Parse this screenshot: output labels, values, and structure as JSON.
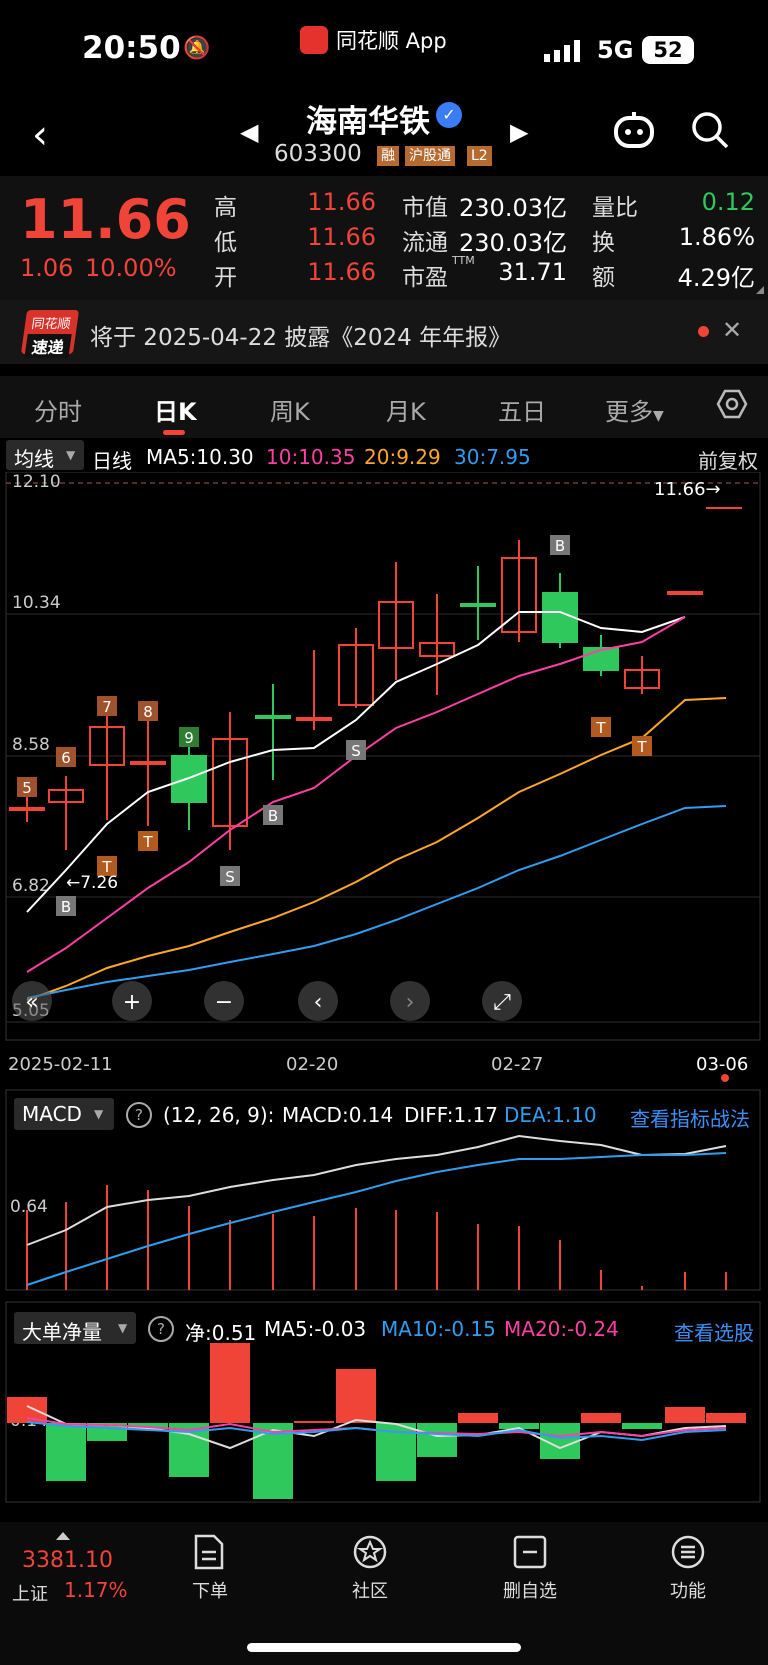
{
  "status_bar": {
    "time": "20:50",
    "app": "同花顺 App",
    "network": "5G",
    "battery": "52"
  },
  "stock": {
    "name": "海南华铁",
    "code": "603300",
    "tags": [
      "融",
      "沪股通",
      "L2"
    ]
  },
  "quote": {
    "price": "11.66",
    "change": "1.06",
    "change_pct": "10.00%",
    "rows": [
      {
        "l1": "高",
        "v1": "11.66",
        "l2": "市值",
        "v2": "230.03亿",
        "l3": "量比",
        "v3": "0.12"
      },
      {
        "l1": "低",
        "v1": "11.66",
        "l2": "流通",
        "v2": "230.03亿",
        "l3": "换",
        "v3": "1.86%"
      },
      {
        "l1": "开",
        "v1": "11.66",
        "l2": "市盈",
        "v2": "31.71",
        "l3": "额",
        "v3": "4.29亿"
      }
    ],
    "pe_sup": "TTM"
  },
  "notice": {
    "logo_top": "同花顺",
    "logo_bottom": "速递",
    "text": "将于 2025-04-22 披露《2024 年年报》"
  },
  "tabs": [
    "分时",
    "日K",
    "周K",
    "月K",
    "五日",
    "更多"
  ],
  "active_tab": "日K",
  "ma_legend": {
    "type": "均线",
    "period": "日线",
    "ma5": "MA5:10.30",
    "ma10": "10:10.35",
    "ma20": "20:9.29",
    "ma30": "30:7.95",
    "adjust": "前复权"
  },
  "kline": {
    "y_labels": [
      "12.10",
      "10.34",
      "8.58",
      "6.82",
      "5.05"
    ],
    "last_price_marker": "11.66→",
    "low_marker": "←7.26",
    "x_labels": [
      "2025-02-11",
      "02-20",
      "02-27",
      "03-06"
    ],
    "controls": [
      "«",
      "+",
      "−",
      "‹",
      "›",
      "⤢"
    ],
    "colors": {
      "up": "#f04438",
      "down": "#2ec85c",
      "ma5": "#ffffff",
      "ma10": "#ff3fa4",
      "ma20": "#ffa726",
      "ma30": "#2f9ef0"
    }
  },
  "macd": {
    "name": "MACD",
    "params": "(12, 26, 9):",
    "macd": "MACD:0.14",
    "diff": "DIFF:1.17",
    "dea": "DEA:1.10",
    "link": "查看指标战法",
    "y_label": "0.64"
  },
  "bigorder": {
    "name": "大单净量",
    "net": "净:0.51",
    "ma5": "MA5:-0.03",
    "ma10": "MA10:-0.15",
    "ma20": "MA20:-0.24",
    "link": "查看选股",
    "y_label": "0.14"
  },
  "bottom": {
    "index_value": "3381.10",
    "index_name": "上证",
    "index_pct": "1.17%",
    "items": [
      "下单",
      "社区",
      "删自选",
      "功能"
    ]
  }
}
